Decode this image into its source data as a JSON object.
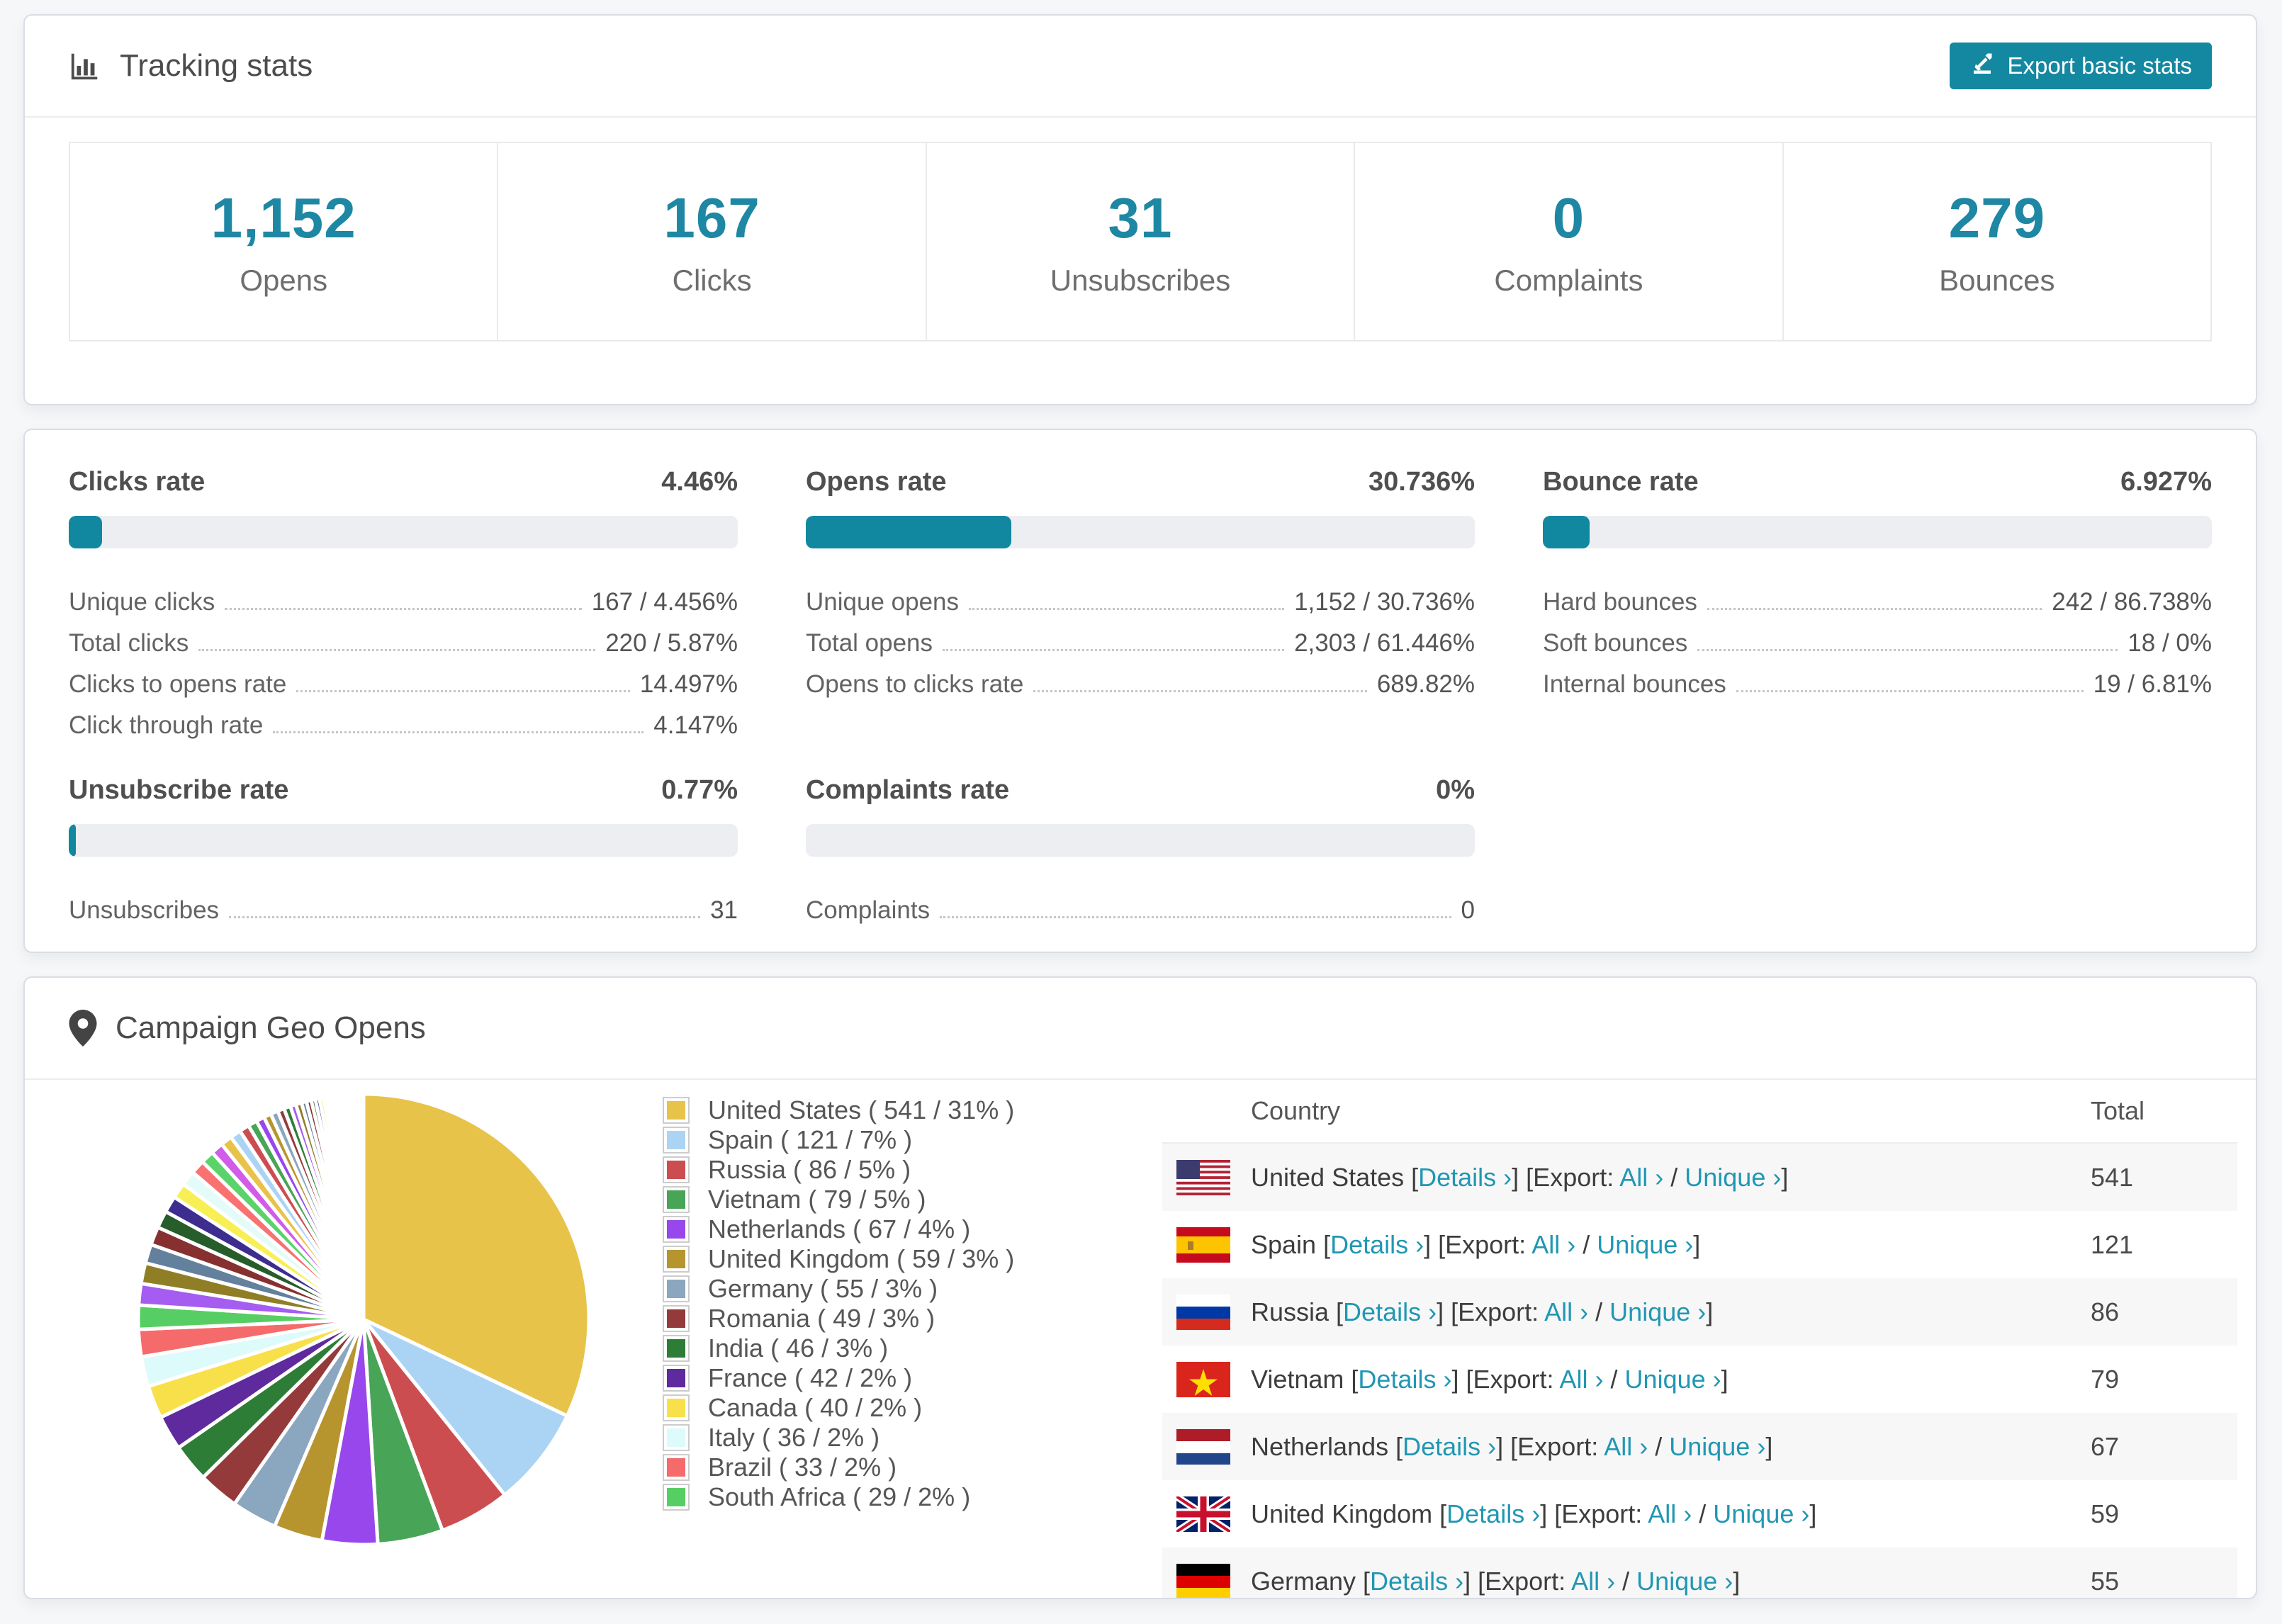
{
  "tracking": {
    "title": "Tracking stats",
    "export_label": "Export basic stats",
    "stats": [
      {
        "value": "1,152",
        "label": "Opens"
      },
      {
        "value": "167",
        "label": "Clicks"
      },
      {
        "value": "31",
        "label": "Unsubscribes"
      },
      {
        "value": "0",
        "label": "Complaints"
      },
      {
        "value": "279",
        "label": "Bounces"
      }
    ]
  },
  "rates": {
    "panels": [
      {
        "title": "Clicks rate",
        "value": "4.46%",
        "bar_pct": 5,
        "rows": [
          {
            "label": "Unique clicks",
            "value": "167 / 4.456%"
          },
          {
            "label": "Total clicks",
            "value": "220 / 5.87%"
          },
          {
            "label": "Clicks to opens rate",
            "value": "14.497%"
          },
          {
            "label": "Click through rate",
            "value": "4.147%"
          }
        ]
      },
      {
        "title": "Opens rate",
        "value": "30.736%",
        "bar_pct": 30.7,
        "rows": [
          {
            "label": "Unique opens",
            "value": "1,152 / 30.736%"
          },
          {
            "label": "Total opens",
            "value": "2,303 / 61.446%"
          },
          {
            "label": "Opens to clicks rate",
            "value": "689.82%"
          }
        ]
      },
      {
        "title": "Bounce rate",
        "value": "6.927%",
        "bar_pct": 7,
        "rows": [
          {
            "label": "Hard bounces",
            "value": "242 / 86.738%"
          },
          {
            "label": "Soft bounces",
            "value": "18 / 0%"
          },
          {
            "label": "Internal bounces",
            "value": "19 / 6.81%"
          }
        ]
      },
      {
        "title": "Unsubscribe rate",
        "value": "0.77%",
        "bar_pct": 1.1,
        "rows": [
          {
            "label": "Unsubscribes",
            "value": "31"
          }
        ]
      },
      {
        "title": "Complaints rate",
        "value": "0%",
        "bar_pct": 0,
        "rows": [
          {
            "label": "Complaints",
            "value": "0"
          }
        ]
      }
    ]
  },
  "geo": {
    "title": "Campaign Geo Opens",
    "legend": [
      {
        "text": "United States ( 541 / 31% )",
        "color": "#e8c34a"
      },
      {
        "text": "Spain ( 121 / 7% )",
        "color": "#abd4f4"
      },
      {
        "text": "Russia ( 86 / 5% )",
        "color": "#cc4d50"
      },
      {
        "text": "Vietnam ( 79 / 5% )",
        "color": "#48a456"
      },
      {
        "text": "Netherlands ( 67 / 4% )",
        "color": "#9747eb"
      },
      {
        "text": "United Kingdom ( 59 / 3% )",
        "color": "#b6952f"
      },
      {
        "text": "Germany ( 55 / 3% )",
        "color": "#8ba6bf"
      },
      {
        "text": "Romania ( 49 / 3% )",
        "color": "#943a3a"
      },
      {
        "text": "India ( 46 / 3% )",
        "color": "#2e7d36"
      },
      {
        "text": "France ( 42 / 2% )",
        "color": "#5f2a9e"
      },
      {
        "text": "Canada ( 40 / 2% )",
        "color": "#f8e04b"
      },
      {
        "text": "Italy ( 36 / 2% )",
        "color": "#dcfbfa"
      },
      {
        "text": "Brazil ( 33 / 2% )",
        "color": "#f56b6b"
      },
      {
        "text": "South Africa ( 29 / 2% )",
        "color": "#57ce63"
      }
    ],
    "table": {
      "country_header": "Country",
      "total_header": "Total",
      "tokens": {
        "lb": "[",
        "rb": "]",
        "details": "Details ›",
        "export": "Export:",
        "all": "All ›",
        "slash": "/",
        "unique": "Unique ›"
      },
      "rows": [
        {
          "country": "United States",
          "flag": "us",
          "total": "541"
        },
        {
          "country": "Spain",
          "flag": "es",
          "total": "121"
        },
        {
          "country": "Russia",
          "flag": "ru",
          "total": "86"
        },
        {
          "country": "Vietnam",
          "flag": "vn",
          "total": "79"
        },
        {
          "country": "Netherlands",
          "flag": "nl",
          "total": "67"
        },
        {
          "country": "United Kingdom",
          "flag": "gb",
          "total": "59"
        },
        {
          "country": "Germany",
          "flag": "de",
          "total": "55"
        }
      ]
    }
  },
  "chart_data": {
    "type": "pie",
    "title": "Campaign Geo Opens",
    "legend_position": "right",
    "start_angle_deg": -90,
    "direction": "clockwise",
    "labels": [
      "United States",
      "Spain",
      "Russia",
      "Vietnam",
      "Netherlands",
      "United Kingdom",
      "Germany",
      "Romania",
      "India",
      "France",
      "Canada",
      "Italy",
      "Brazil",
      "South Africa"
    ],
    "values": [
      541,
      121,
      86,
      79,
      67,
      59,
      55,
      49,
      46,
      42,
      40,
      36,
      33,
      29
    ],
    "percents": [
      31,
      7,
      5,
      5,
      4,
      3,
      3,
      3,
      3,
      2,
      2,
      2,
      2,
      2
    ],
    "colors": [
      "#e8c34a",
      "#abd4f4",
      "#cc4d50",
      "#48a456",
      "#9747eb",
      "#b6952f",
      "#8ba6bf",
      "#943a3a",
      "#2e7d36",
      "#5f2a9e",
      "#f8e04b",
      "#dcfbfa",
      "#f56b6b",
      "#57ce63"
    ],
    "others_values": [
      26,
      25,
      23,
      22,
      21,
      20,
      19,
      18,
      17,
      16,
      15,
      14,
      13,
      12,
      11,
      10,
      9,
      9,
      8,
      8,
      7,
      7,
      6,
      6,
      5,
      5,
      5,
      4,
      4,
      4,
      3,
      3,
      3,
      3,
      2,
      2,
      2,
      2,
      2,
      2,
      1,
      1,
      1,
      1,
      1,
      1,
      1,
      1,
      1,
      1,
      1,
      1
    ],
    "others_colors_cycle": [
      "#a55cf0",
      "#8f7e26",
      "#63809c",
      "#86302f",
      "#275c2b",
      "#3c2d8f",
      "#f8ef55",
      "#e3fbf9",
      "#f87272",
      "#5bd36b",
      "#d05ce8",
      "#e8c34a",
      "#abd4f4",
      "#cc4d50",
      "#48a456",
      "#9747eb",
      "#b6952f",
      "#8ba6bf",
      "#943a3a",
      "#2e7d36"
    ]
  }
}
